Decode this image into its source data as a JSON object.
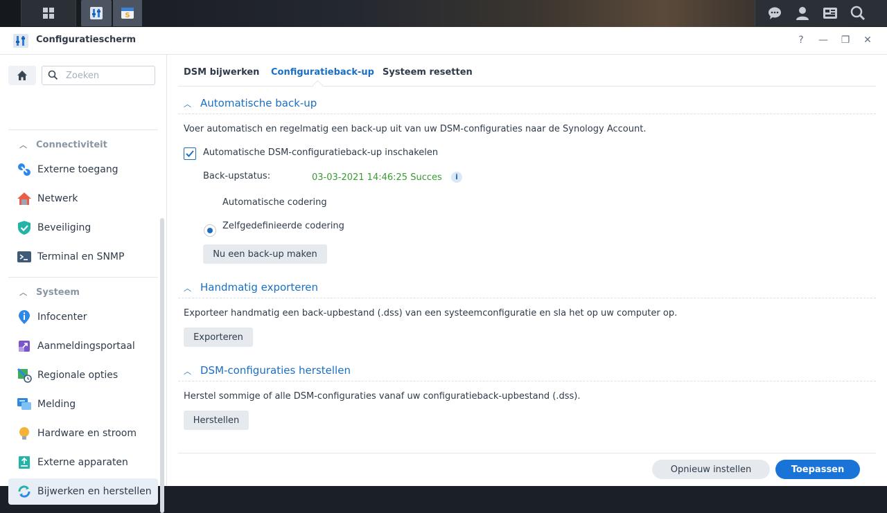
{
  "window": {
    "title": "Configuratiescherm"
  },
  "window_controls": {
    "help": "?",
    "minimize": "—",
    "restore": "❐",
    "close": "✕"
  },
  "sidebar": {
    "search_placeholder": "Zoeken",
    "groups": [
      {
        "label": "Connectiviteit"
      },
      {
        "label": "Systeem"
      }
    ],
    "items": [
      {
        "label": "Externe toegang",
        "icon": "remote-access-icon"
      },
      {
        "label": "Netwerk",
        "icon": "network-house-icon"
      },
      {
        "label": "Beveiliging",
        "icon": "shield-icon"
      },
      {
        "label": "Terminal en SNMP",
        "icon": "terminal-icon"
      },
      {
        "label": "Infocenter",
        "icon": "info-icon"
      },
      {
        "label": "Aanmeldingsportaal",
        "icon": "login-portal-icon"
      },
      {
        "label": "Regionale opties",
        "icon": "regional-icon"
      },
      {
        "label": "Melding",
        "icon": "notification-icon"
      },
      {
        "label": "Hardware en stroom",
        "icon": "bulb-icon"
      },
      {
        "label": "Externe apparaten",
        "icon": "external-device-icon"
      },
      {
        "label": "Bijwerken en herstellen",
        "icon": "update-restore-icon"
      }
    ]
  },
  "tabs": [
    {
      "label": "DSM bijwerken"
    },
    {
      "label": "Configuratieback-up"
    },
    {
      "label": "Systeem resetten"
    }
  ],
  "auto_backup": {
    "title": "Automatische back-up",
    "description": "Voer automatisch en regelmatig een back-up uit van uw DSM-configuraties naar de Synology Account.",
    "enable_label": "Automatische DSM-configuratieback-up inschakelen",
    "status_label": "Back-upstatus:",
    "status_value": "03-03-2021 14:46:25 Succes",
    "radio_auto": "Automatische codering",
    "radio_custom": "Zelfgedefinieerde codering",
    "backup_now": "Nu een back-up maken"
  },
  "manual_export": {
    "title": "Handmatig exporteren",
    "description": "Exporteer handmatig een back-upbestand (.dss) van een systeemconfiguratie en sla het op uw computer op.",
    "button": "Exporteren"
  },
  "restore": {
    "title": "DSM-configuraties herstellen",
    "description": "Herstel sommige of alle DSM-configuraties vanaf uw configuratieback-upbestand (.dss).",
    "button": "Herstellen"
  },
  "footer": {
    "reset": "Opnieuw instellen",
    "apply": "Toepassen"
  },
  "colors": {
    "accent": "#1a6fc4",
    "success": "#3a9a34",
    "primary_button": "#1a74d8"
  }
}
